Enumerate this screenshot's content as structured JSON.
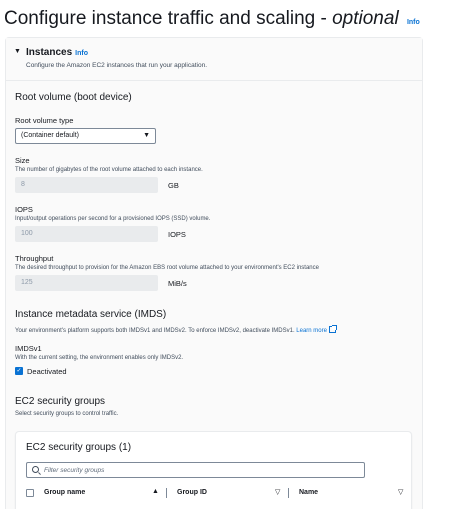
{
  "page": {
    "title_main": "Configure instance traffic and scaling - ",
    "title_optional": "optional",
    "info": "Info"
  },
  "instances": {
    "heading": "Instances",
    "info": "Info",
    "description": "Configure the Amazon EC2 instances that run your application.",
    "toggle_icon": "caret-down-icon"
  },
  "root_volume": {
    "heading": "Root volume (boot device)",
    "type_label": "Root volume type",
    "type_value": "(Container default)",
    "size": {
      "label": "Size",
      "description": "The number of gigabytes of the root volume attached to each instance.",
      "value": "8",
      "unit": "GB"
    },
    "iops": {
      "label": "IOPS",
      "description": "Input/output operations per second for a provisioned IOPS (SSD) volume.",
      "value": "100",
      "unit": "IOPS"
    },
    "throughput": {
      "label": "Throughput",
      "description": "The desired throughput to provision for the Amazon EBS root volume attached to your environment's EC2 instance",
      "value": "125",
      "unit": "MiB/s"
    }
  },
  "imds": {
    "heading": "Instance metadata service (IMDS)",
    "description": "Your environment's platform supports both IMDSv1 and IMDSv2. To enforce IMDSv2, deactivate IMDSv1.",
    "learn_more": "Learn more",
    "imdsv1_label": "IMDSv1",
    "imdsv1_description": "With the current setting, the environment enables only IMDSv2.",
    "checkbox_label": "Deactivated",
    "checked": true
  },
  "security_groups": {
    "heading": "EC2 security groups",
    "description": "Select security groups to control traffic.",
    "table_title": "EC2 security groups (1)",
    "filter_placeholder": "Filter security groups",
    "columns": [
      "Group name",
      "Group ID",
      "Name"
    ]
  },
  "colors": {
    "link": "#0972d3",
    "text": "#16191f",
    "secondary_text": "#414d5c",
    "disabled_bg": "#e9ebed",
    "panel_bg": "#fafafa"
  }
}
